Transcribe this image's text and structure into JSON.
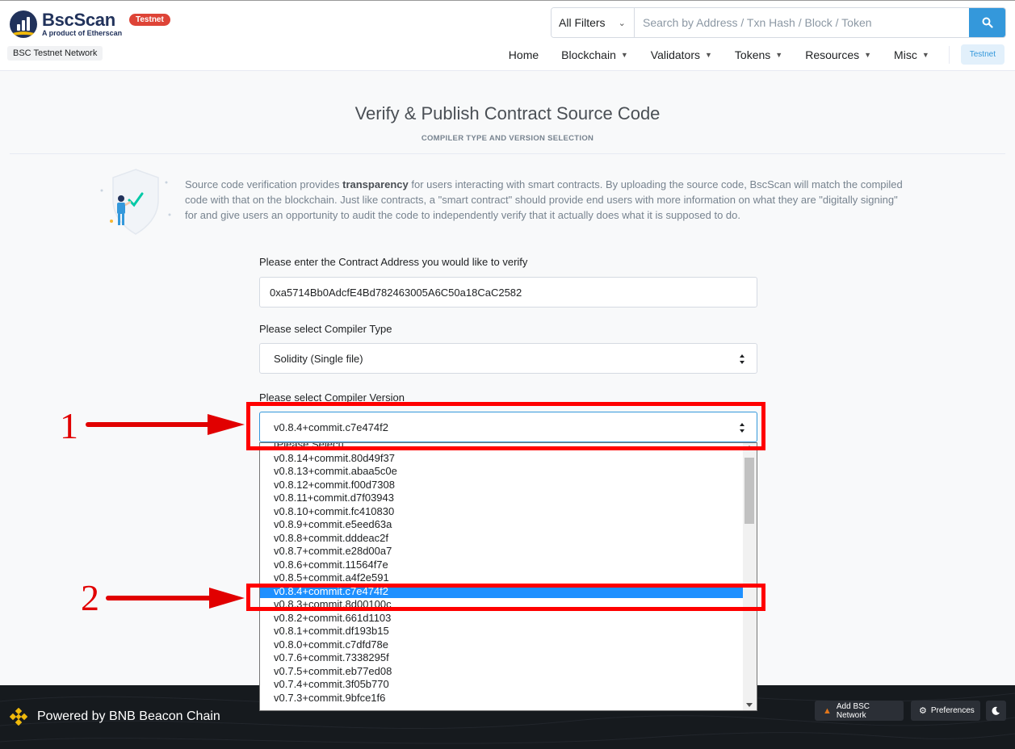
{
  "header": {
    "logo_name": "BscScan",
    "logo_sub": "A product of Etherscan",
    "badge": "Testnet",
    "network": "BSC Testnet Network",
    "filter_label": "All Filters",
    "search_placeholder": "Search by Address / Txn Hash / Block / Token",
    "nav": [
      "Home",
      "Blockchain",
      "Validators",
      "Tokens",
      "Resources",
      "Misc"
    ],
    "nav_testnet": "Testnet"
  },
  "page": {
    "title": "Verify & Publish Contract Source Code",
    "subtitle": "COMPILER TYPE AND VERSION SELECTION",
    "intro_pre": "Source code verification provides ",
    "intro_bold": "transparency",
    "intro_post": " for users interacting with smart contracts. By uploading the source code, BscScan will match the compiled code with that on the blockchain. Just like contracts, a \"smart contract\" should provide end users with more information on what they are \"digitally signing\" for and give users an opportunity to audit the code to independently verify that it actually does what it is supposed to do."
  },
  "form": {
    "address_label": "Please enter the Contract Address you would like to verify",
    "address_value": "0xa5714Bb0AdcfE4Bd782463005A6C50a18CaC2582",
    "type_label": "Please select Compiler Type",
    "type_value": "Solidity (Single file)",
    "version_label": "Please select Compiler Version",
    "version_value": "v0.8.4+commit.c7e474f2"
  },
  "dropdown": {
    "items": [
      "[Please Select]",
      "v0.8.14+commit.80d49f37",
      "v0.8.13+commit.abaa5c0e",
      "v0.8.12+commit.f00d7308",
      "v0.8.11+commit.d7f03943",
      "v0.8.10+commit.fc410830",
      "v0.8.9+commit.e5eed63a",
      "v0.8.8+commit.dddeac2f",
      "v0.8.7+commit.e28d00a7",
      "v0.8.6+commit.11564f7e",
      "v0.8.5+commit.a4f2e591",
      "v0.8.4+commit.c7e474f2",
      "v0.8.3+commit.8d00100c",
      "v0.8.2+commit.661d1103",
      "v0.8.1+commit.df193b15",
      "v0.8.0+commit.c7dfd78e",
      "v0.7.6+commit.7338295f",
      "v0.7.5+commit.eb77ed08",
      "v0.7.4+commit.3f05b770",
      "v0.7.3+commit.9bfce1f6"
    ],
    "selected_index": 11
  },
  "footer": {
    "brand": "Powered by BNB Beacon Chain",
    "add_network": "Add BSC Network",
    "preferences": "Preferences"
  },
  "annotations": {
    "step1": "1",
    "step2": "2"
  },
  "colors": {
    "accent": "#3498db",
    "badge": "#de4437",
    "annotation": "#ff0000",
    "selection": "#1e90ff"
  }
}
